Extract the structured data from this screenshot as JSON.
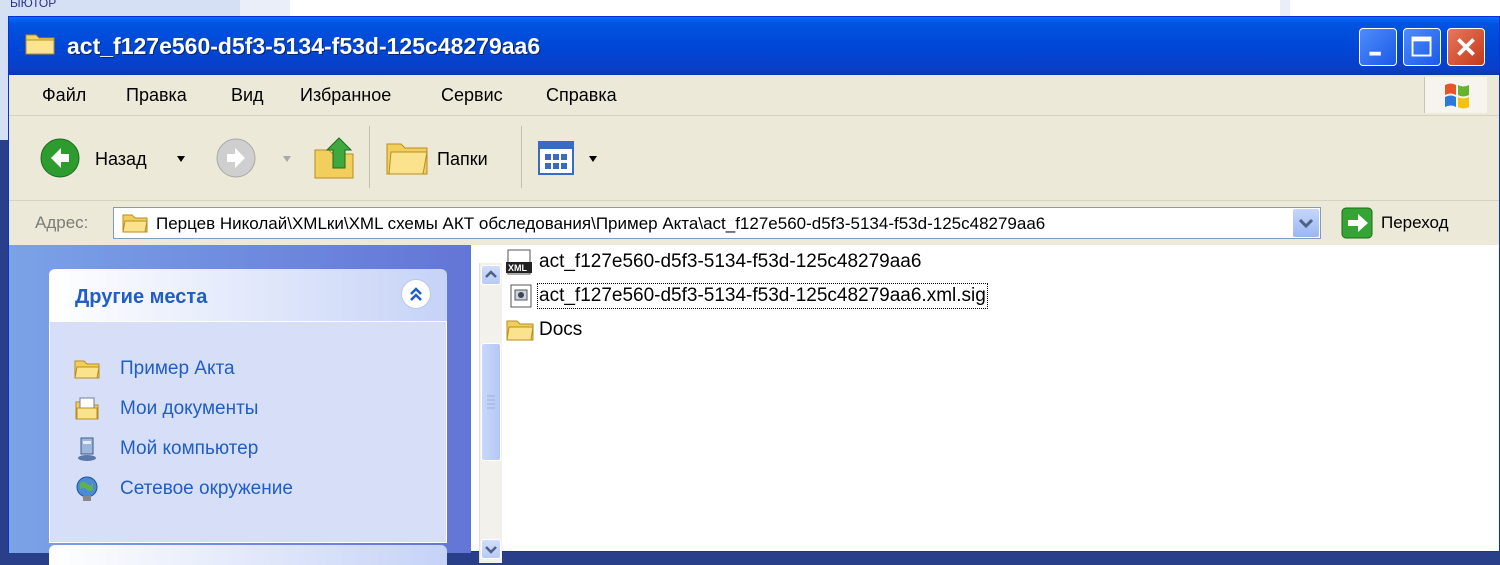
{
  "background": {
    "fragment_text": "ЫЮТОР"
  },
  "window": {
    "title": "act_f127e560-d5f3-5134-f53d-125c48279aa6",
    "controls": [
      "minimize",
      "maximize",
      "close"
    ]
  },
  "menu": {
    "items": [
      "Файл",
      "Правка",
      "Вид",
      "Избранное",
      "Сервис",
      "Справка"
    ]
  },
  "toolbar": {
    "back_label": "Назад",
    "folders_label": "Папки"
  },
  "address": {
    "label": "Адрес:",
    "path": "Перцев Николай\\XMLки\\XML схемы АКТ обследования\\Пример Акта\\act_f127e560-d5f3-5134-f53d-125c48279aa6",
    "go_label": "Переход"
  },
  "taskpane": {
    "other_places_title": "Другие места",
    "places": [
      {
        "label": "Пример Акта",
        "icon": "folder-icon"
      },
      {
        "label": "Мои документы",
        "icon": "my-documents-icon"
      },
      {
        "label": "Мой компьютер",
        "icon": "my-computer-icon"
      },
      {
        "label": "Сетевое окружение",
        "icon": "network-icon"
      }
    ]
  },
  "files": [
    {
      "name": "act_f127e560-d5f3-5134-f53d-125c48279aa6",
      "icon": "xml-file-icon"
    },
    {
      "name": "act_f127e560-d5f3-5134-f53d-125c48279aa6.xml.sig",
      "icon": "sig-file-icon",
      "selected": true
    },
    {
      "name": "Docs",
      "icon": "folder-icon"
    }
  ],
  "colors": {
    "titlebar": "#0046d6",
    "link": "#215dc6",
    "chrome": "#ece9d8"
  }
}
